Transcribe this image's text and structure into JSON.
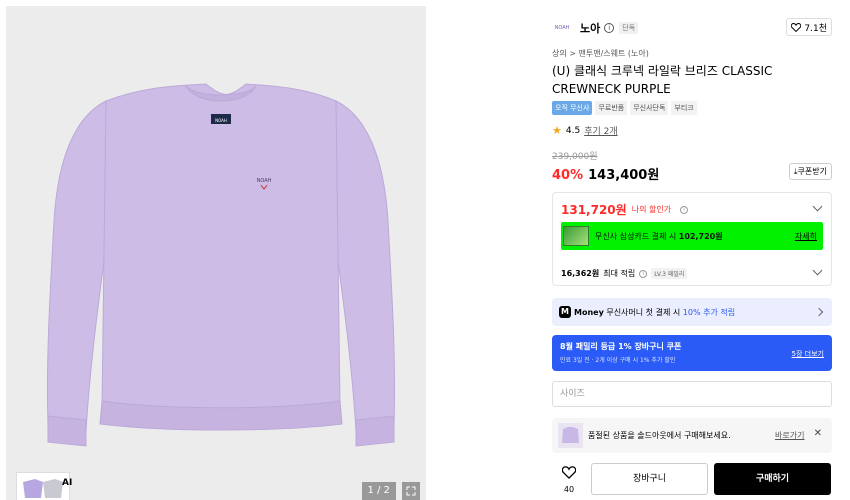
{
  "gallery": {
    "counter": "1 / 2",
    "thumb_label": "AI",
    "garment_color": "#cdbce6",
    "logo_text": "NOAH"
  },
  "brand": {
    "logo_text": "NOAH",
    "name": "노아",
    "tag": "단독",
    "likes": "7.1천"
  },
  "breadcrumb": "상의 > 맨투맨/스웨트 (노아)",
  "title": "(U) 클래식 크루넥 라일락 브리즈 CLASSIC CREWNECK PURPLE",
  "tags": [
    {
      "label": "오직 무신사",
      "style": "blue"
    },
    {
      "label": "무료반품"
    },
    {
      "label": "무신사단독"
    },
    {
      "label": "부티크"
    }
  ],
  "rating": {
    "score": "4.5",
    "reviews": "후기 2개"
  },
  "pricing": {
    "original": "239,000원",
    "discount": "40%",
    "price": "143,400원",
    "coupon_label": "쿠폰받기"
  },
  "benefits": {
    "my_price": "131,720원",
    "my_price_label": "나의 할인가",
    "card_text_prefix": "무신사 삼성카드 결제 시 ",
    "card_price": "102,720원",
    "card_detail": "자세히",
    "points": "16,362원",
    "points_label": "최대 적립",
    "level": "LV.3 패밀리"
  },
  "money_bar": {
    "icon": "M",
    "brand": "Money",
    "text": " 무신사머니 첫 결제 시 ",
    "highlight": "10% 추가 적립"
  },
  "coupon_banner": {
    "title": "8월 패밀리 등급 1% 장바구니 쿠폰",
    "subtitle": "만료 3일 전 · 2개 이상 구매 시 1% 추가 할인",
    "more": "5장 더보기"
  },
  "size_select": {
    "placeholder": "사이즈"
  },
  "restock": {
    "text": "품절된 상품을 솔드아웃에서 구매해보세요.",
    "link": "바로가기"
  },
  "actions": {
    "like_count": "40",
    "cart": "장바구니",
    "buy": "구매하기"
  },
  "colors": {
    "discount_red": "#ff2a2a",
    "accent_blue": "#2a5bf6",
    "card_banner_green": "#00f000",
    "buy_button": "#000000"
  }
}
